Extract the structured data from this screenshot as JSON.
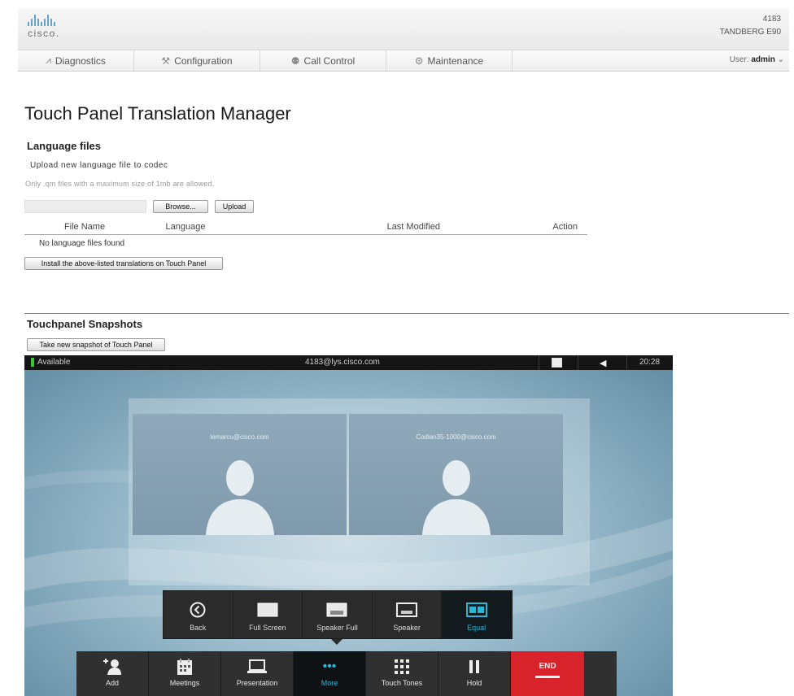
{
  "header": {
    "brand": "cisco.",
    "device_id": "4183",
    "device_model": "TANDBERG E90"
  },
  "nav": {
    "items": [
      {
        "label": "Diagnostics",
        "icon": "pulse-icon"
      },
      {
        "label": "Configuration",
        "icon": "wrench-icon"
      },
      {
        "label": "Call Control",
        "icon": "people-icon"
      },
      {
        "label": "Maintenance",
        "icon": "gear-icon"
      }
    ],
    "user_prefix": "User:",
    "user_name": "admin"
  },
  "page": {
    "title": "Touch Panel Translation Manager"
  },
  "language_files": {
    "heading": "Language files",
    "upload_title": "Upload new language file to codec",
    "upload_hint": "Only .qm files with a maximum size of 1mb are allowed.",
    "browse_label": "Browse...",
    "upload_label": "Upload",
    "columns": [
      "File Name",
      "Language",
      "Last Modified",
      "Action"
    ],
    "empty_text": "No language files found",
    "install_label": "Install the above-listed translations on Touch Panel"
  },
  "snapshots": {
    "heading": "Touchpanel Snapshots",
    "take_label": "Take new snapshot of Touch Panel"
  },
  "touchpanel": {
    "status": "Available",
    "uri": "4183@lys.cisco.com",
    "time": "20:28",
    "participants": [
      {
        "uri": "lemarcu@cisco.com"
      },
      {
        "uri": "Codian35-1000@cisco.com"
      }
    ],
    "layout_menu": [
      {
        "label": "Back",
        "icon": "back-icon",
        "active": false
      },
      {
        "label": "Full Screen",
        "icon": "fullscreen-icon",
        "active": false
      },
      {
        "label": "Speaker Full",
        "icon": "speaker-full-icon",
        "active": false
      },
      {
        "label": "Speaker",
        "icon": "speaker-layout-icon",
        "active": false
      },
      {
        "label": "Equal",
        "icon": "equal-icon",
        "active": true
      }
    ],
    "dock": [
      {
        "label": "Add",
        "icon": "add-participant-icon"
      },
      {
        "label": "Meetings",
        "icon": "calendar-icon"
      },
      {
        "label": "Presentation",
        "icon": "laptop-icon"
      },
      {
        "label": "More",
        "icon": "more-icon"
      },
      {
        "label": "Touch Tones",
        "icon": "keypad-icon"
      },
      {
        "label": "Hold",
        "icon": "pause-icon"
      },
      {
        "label": "END",
        "icon": "end-call-icon"
      }
    ],
    "colors": {
      "accent": "#27b8d8",
      "end": "#d8232a",
      "available": "#3cc43c"
    }
  }
}
